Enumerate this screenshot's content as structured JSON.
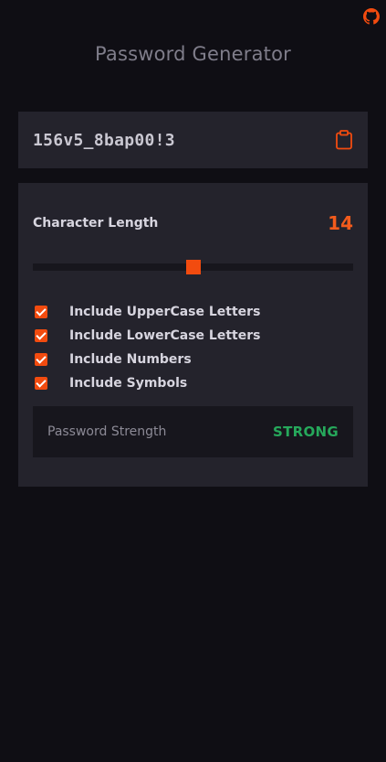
{
  "app": {
    "title": "Password Generator"
  },
  "header": {
    "github_icon": "github-icon",
    "accent_color": "#f24b0f"
  },
  "output": {
    "password": "156v5_8bap00!3",
    "copy_icon": "clipboard-icon"
  },
  "settings": {
    "length_label": "Character Length",
    "length_value": "14",
    "slider": {
      "min": 4,
      "max": 24,
      "value": 14
    },
    "options": [
      {
        "label": "Include UpperCase Letters",
        "checked": true
      },
      {
        "label": "Include LowerCase Letters",
        "checked": true
      },
      {
        "label": "Include Numbers",
        "checked": true
      },
      {
        "label": "Include Symbols",
        "checked": true
      }
    ]
  },
  "strength": {
    "label": "Password Strength",
    "value": "STRONG",
    "color": "#26a85b"
  }
}
